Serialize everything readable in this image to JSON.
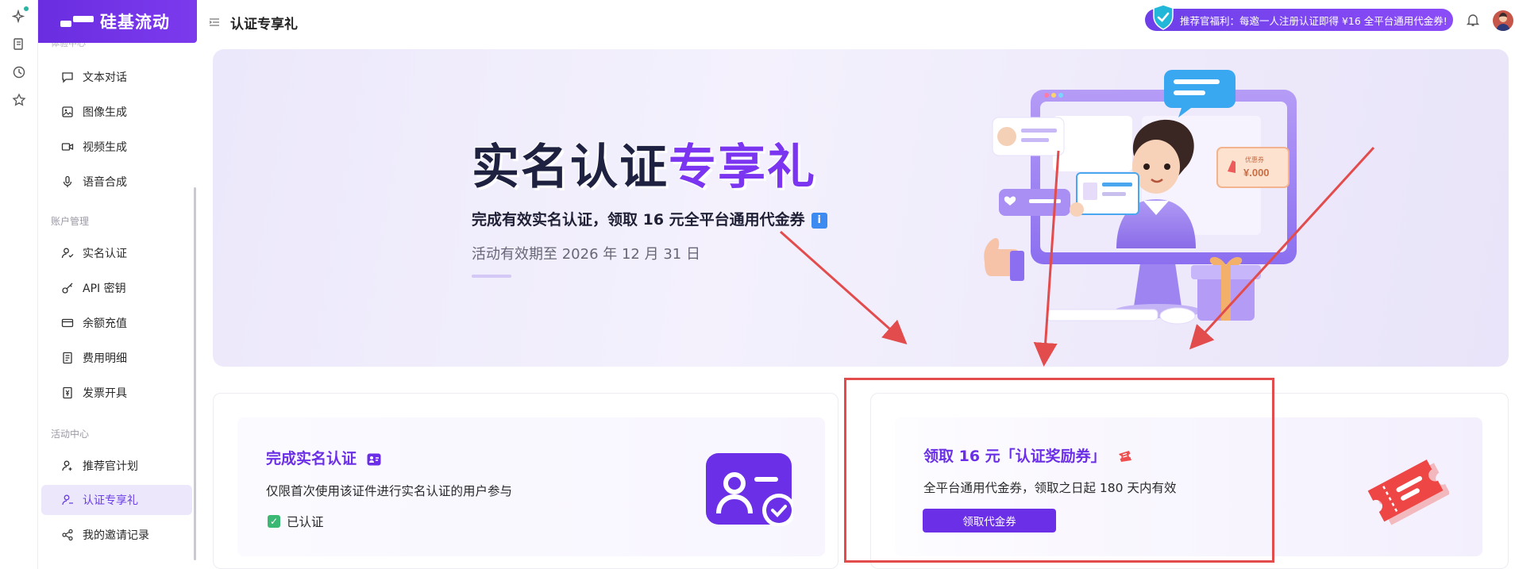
{
  "brand": {
    "name": "硅基流动"
  },
  "rail": {
    "icons": [
      "sparkle-icon",
      "document-icon",
      "history-icon",
      "star-icon"
    ]
  },
  "sidebar": {
    "cut_section": "体验中心",
    "sections": [
      {
        "label": "",
        "items": [
          {
            "label": "文本对话",
            "icon": "chat-icon"
          },
          {
            "label": "图像生成",
            "icon": "image-icon"
          },
          {
            "label": "视频生成",
            "icon": "video-icon"
          },
          {
            "label": "语音合成",
            "icon": "mic-icon"
          }
        ]
      },
      {
        "label": "账户管理",
        "items": [
          {
            "label": "实名认证",
            "icon": "user-check-icon"
          },
          {
            "label": "API 密钥",
            "icon": "key-icon"
          },
          {
            "label": "余额充值",
            "icon": "card-icon"
          },
          {
            "label": "费用明细",
            "icon": "bill-icon"
          },
          {
            "label": "发票开具",
            "icon": "invoice-icon"
          }
        ]
      },
      {
        "label": "活动中心",
        "items": [
          {
            "label": "推荐官计划",
            "icon": "referral-icon"
          },
          {
            "label": "认证专享礼",
            "icon": "gift-user-icon",
            "active": true
          },
          {
            "label": "我的邀请记录",
            "icon": "share-icon"
          }
        ]
      }
    ]
  },
  "header": {
    "title": "认证专享礼",
    "promo": "推荐官福利：每邀一人注册认证即得 ¥16 全平台通用代金券!"
  },
  "hero": {
    "title_main": "实名认证",
    "title_highlight": "专享礼",
    "subtitle": "完成有效实名认证，领取 16 元全平台通用代金券",
    "info_glyph": "i",
    "validity": "活动有效期至 2026 年 12 月 31 日",
    "illustration": {
      "coupon_text": "¥.000",
      "coupon_label": "优惠券"
    }
  },
  "card_verify": {
    "title": "完成实名认证",
    "desc": "仅限首次使用该证件进行实名认证的用户参与",
    "status": "已认证"
  },
  "card_reward": {
    "title": "领取 16 元「认证奖励券」",
    "desc": "全平台通用代金券，领取之日起 180 天内有效",
    "button": "领取代金券"
  },
  "colors": {
    "accent": "#6a2fe6",
    "annotation": "#e24c4c",
    "verified": "#3bb873"
  }
}
